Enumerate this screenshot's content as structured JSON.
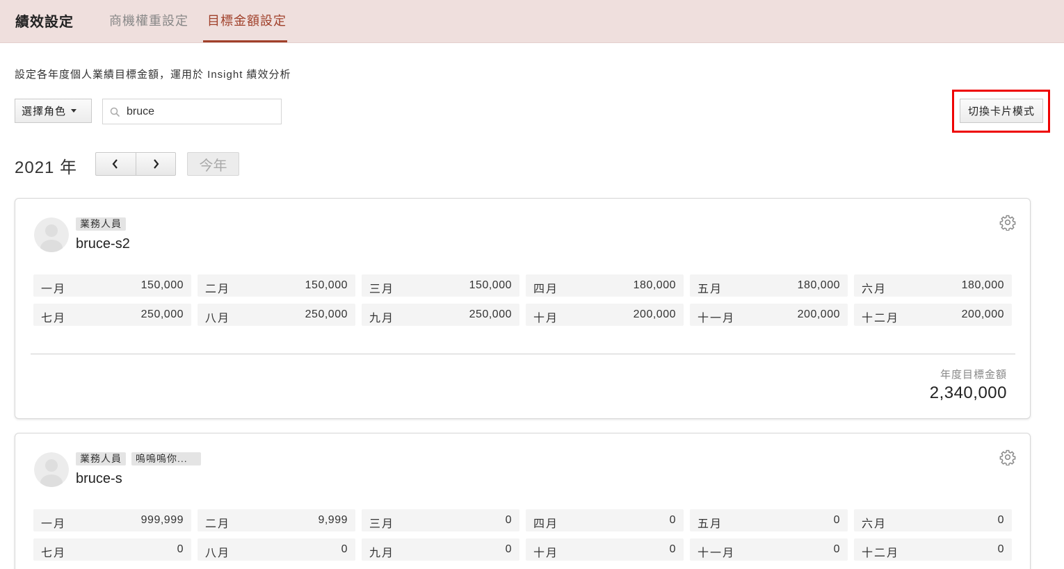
{
  "header": {
    "app_title": "績效設定",
    "tabs": [
      {
        "label": "商機權重設定",
        "active": false
      },
      {
        "label": "目標金額設定",
        "active": true
      }
    ]
  },
  "description": "設定各年度個人業績目標金額，運用於 Insight 績效分析",
  "filters": {
    "role_select_label": "選擇角色",
    "search_value": "bruce",
    "toggle_mode_label": "切換卡片模式"
  },
  "year_nav": {
    "year_label": "2021 年",
    "this_year_label": "今年"
  },
  "colors": {
    "header_bg": "#efdfdd",
    "accent": "#a0402a",
    "highlight": "#ee0000"
  },
  "cards": [
    {
      "name": "bruce-s2",
      "tags": [
        "業務人員"
      ],
      "months": [
        {
          "label": "一月",
          "value": "150,000"
        },
        {
          "label": "二月",
          "value": "150,000"
        },
        {
          "label": "三月",
          "value": "150,000"
        },
        {
          "label": "四月",
          "value": "180,000"
        },
        {
          "label": "五月",
          "value": "180,000"
        },
        {
          "label": "六月",
          "value": "180,000"
        },
        {
          "label": "七月",
          "value": "250,000"
        },
        {
          "label": "八月",
          "value": "250,000"
        },
        {
          "label": "九月",
          "value": "250,000"
        },
        {
          "label": "十月",
          "value": "200,000"
        },
        {
          "label": "十一月",
          "value": "200,000"
        },
        {
          "label": "十二月",
          "value": "200,000"
        }
      ],
      "total_label": "年度目標金額",
      "total_value": "2,340,000"
    },
    {
      "name": "bruce-s",
      "tags": [
        "業務人員",
        "嗚嗚嗚你..."
      ],
      "months": [
        {
          "label": "一月",
          "value": "999,999"
        },
        {
          "label": "二月",
          "value": "9,999"
        },
        {
          "label": "三月",
          "value": "0"
        },
        {
          "label": "四月",
          "value": "0"
        },
        {
          "label": "五月",
          "value": "0"
        },
        {
          "label": "六月",
          "value": "0"
        },
        {
          "label": "七月",
          "value": "0"
        },
        {
          "label": "八月",
          "value": "0"
        },
        {
          "label": "九月",
          "value": "0"
        },
        {
          "label": "十月",
          "value": "0"
        },
        {
          "label": "十一月",
          "value": "0"
        },
        {
          "label": "十二月",
          "value": "0"
        }
      ]
    }
  ]
}
